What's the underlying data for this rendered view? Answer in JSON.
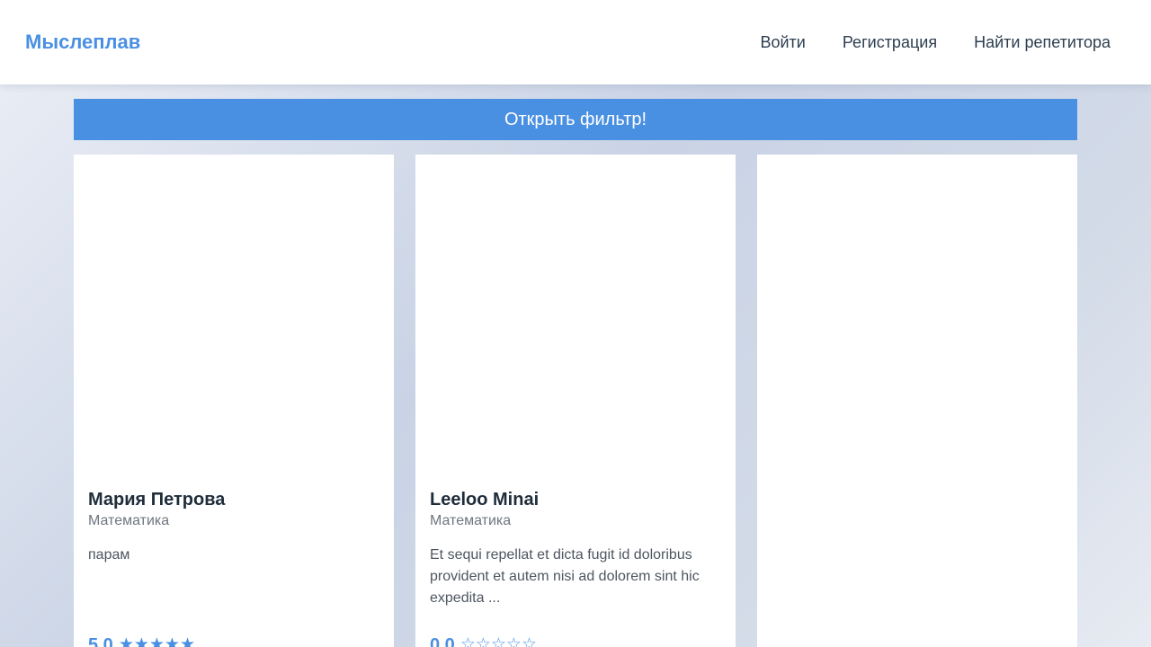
{
  "header": {
    "logo": "Мыслеплав",
    "nav": {
      "login": "Войти",
      "register": "Регистрация",
      "find_tutor": "Найти репетитора"
    }
  },
  "filter": {
    "button_label": "Открыть фильтр!"
  },
  "tutors": [
    {
      "name": "Мария Петрова",
      "subject": "Математика",
      "description": "парам",
      "rating": "5.0",
      "stars": "★★★★★"
    },
    {
      "name": "Leeloo Minai",
      "subject": "Математика",
      "description": "Et sequi repellat et dicta fugit id doloribus provident et autem nisi ad dolorem sint hic expedita ...",
      "rating": "0.0",
      "stars": "☆☆☆☆☆"
    }
  ],
  "colors": {
    "accent": "#4a90e2",
    "nav_text": "#2c3e50"
  }
}
